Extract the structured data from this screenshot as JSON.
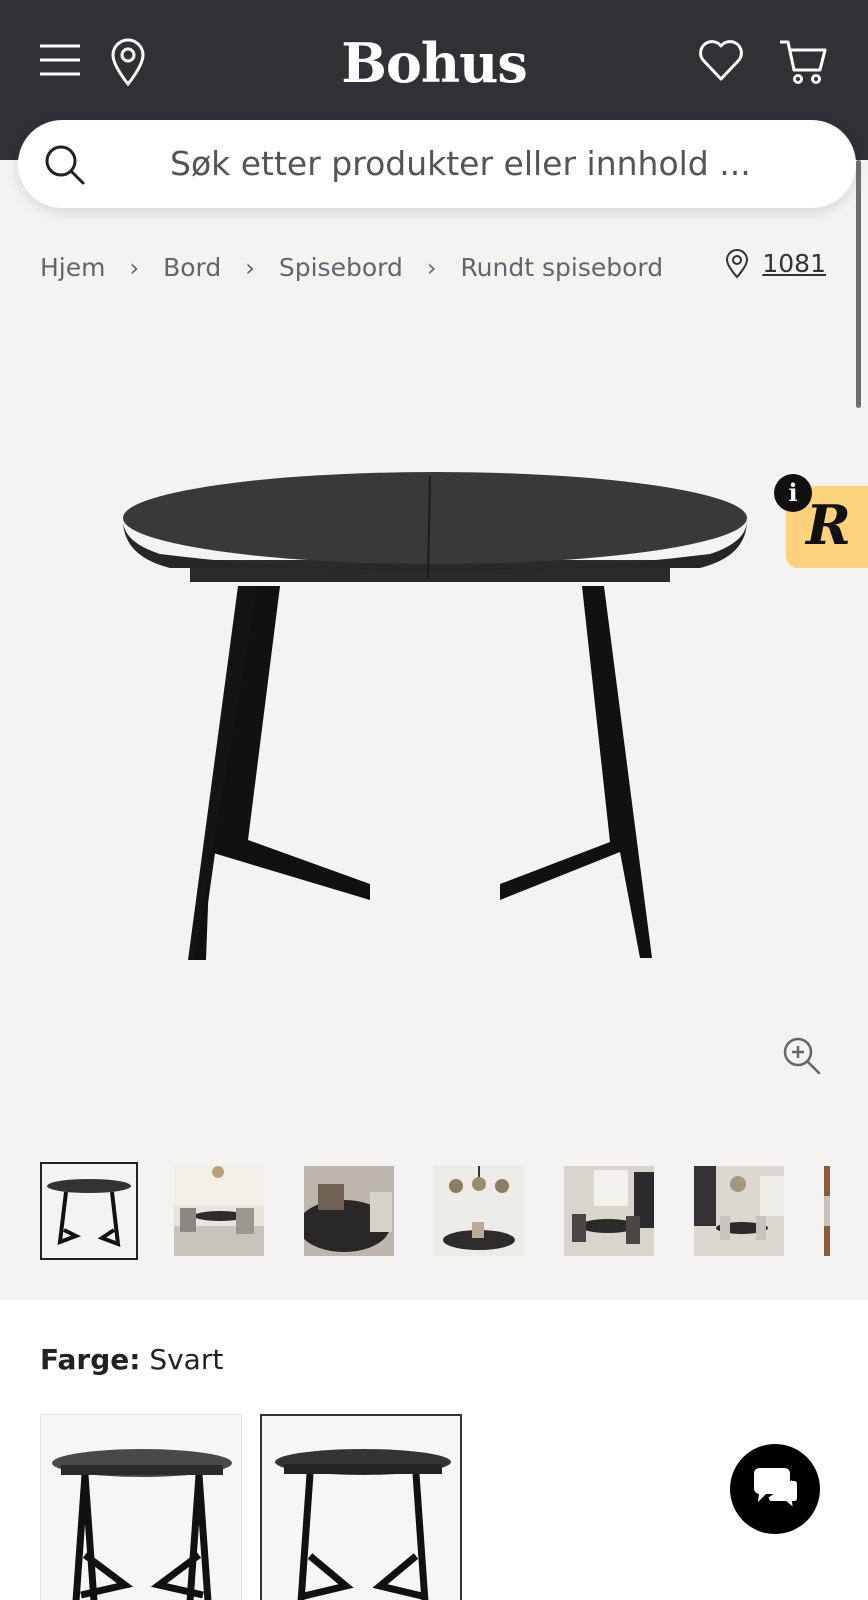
{
  "header": {
    "logo": "Bohus",
    "icons": [
      "menu-icon",
      "location-pin-icon",
      "heart-icon",
      "cart-icon"
    ]
  },
  "search": {
    "placeholder": "Søk etter produkter eller innhold ..."
  },
  "breadcrumb": [
    "Hjem",
    "Bord",
    "Spisebord",
    "Rundt spisebord"
  ],
  "store": {
    "number": "1081"
  },
  "product": {
    "color_label": "Farge:",
    "color_value": "Svart",
    "thumbnail_count_visible": 7,
    "selected_thumbnail": 1,
    "selected_swatch": 2
  },
  "badge": {
    "letter": "R",
    "info": "i",
    "background": "#fdd27d"
  },
  "colors": {
    "header_bg": "#313035",
    "page_bg": "#f4f3f1",
    "accent": "#fdd27d"
  }
}
